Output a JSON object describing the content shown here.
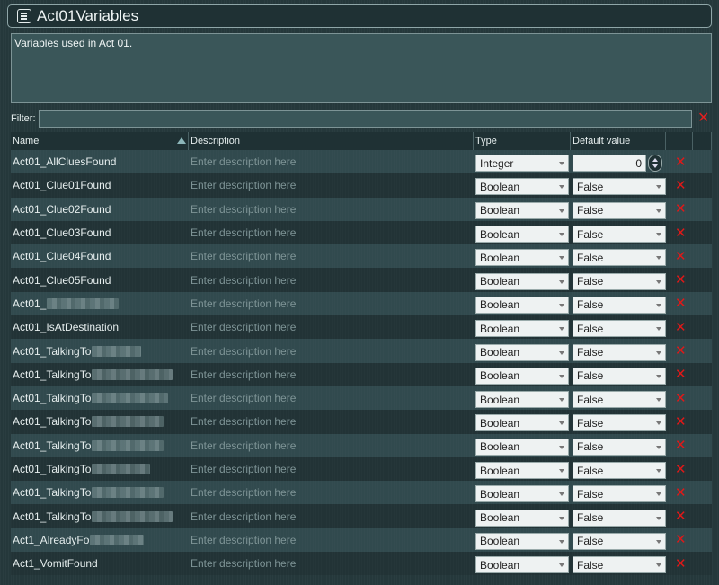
{
  "window": {
    "title": "Act01Variables",
    "description": "Variables used in Act 01."
  },
  "filter": {
    "label": "Filter:",
    "value": ""
  },
  "table": {
    "headers": {
      "name": "Name",
      "description": "Description",
      "type": "Type",
      "default": "Default value"
    },
    "description_placeholder": "Enter description here",
    "rows": [
      {
        "name": "Act01_AllCluesFound",
        "type": "Integer",
        "default": "0"
      },
      {
        "name": "Act01_Clue01Found",
        "type": "Boolean",
        "default": "False"
      },
      {
        "name": "Act01_Clue02Found",
        "type": "Boolean",
        "default": "False"
      },
      {
        "name": "Act01_Clue03Found",
        "type": "Boolean",
        "default": "False"
      },
      {
        "name": "Act01_Clue04Found",
        "type": "Boolean",
        "default": "False"
      },
      {
        "name": "Act01_Clue05Found",
        "type": "Boolean",
        "default": "False"
      },
      {
        "name": "Act01_",
        "type": "Boolean",
        "default": "False",
        "redacted": true
      },
      {
        "name": "Act01_IsAtDestination",
        "type": "Boolean",
        "default": "False"
      },
      {
        "name": "Act01_TalkingTo",
        "type": "Boolean",
        "default": "False",
        "redacted": true
      },
      {
        "name": "Act01_TalkingTo",
        "type": "Boolean",
        "default": "False",
        "redacted": true
      },
      {
        "name": "Act01_TalkingTo",
        "type": "Boolean",
        "default": "False",
        "redacted": true
      },
      {
        "name": "Act01_TalkingTo",
        "type": "Boolean",
        "default": "False",
        "redacted": true
      },
      {
        "name": "Act01_TalkingTo",
        "type": "Boolean",
        "default": "False",
        "redacted": true
      },
      {
        "name": "Act01_TalkingTo",
        "type": "Boolean",
        "default": "False",
        "redacted": true
      },
      {
        "name": "Act01_TalkingTo",
        "type": "Boolean",
        "default": "False",
        "redacted": true
      },
      {
        "name": "Act01_TalkingTo",
        "type": "Boolean",
        "default": "False",
        "redacted": true
      },
      {
        "name": "Act1_AlreadyFo",
        "type": "Boolean",
        "default": "False",
        "redacted": true
      },
      {
        "name": "Act1_VomitFound",
        "type": "Boolean",
        "default": "False"
      }
    ]
  },
  "colors": {
    "background": "#25383b",
    "delete_icon": "#e11818"
  },
  "icons": {
    "title": "list-icon",
    "filter_clear": "close-icon",
    "row_delete": "close-icon"
  }
}
